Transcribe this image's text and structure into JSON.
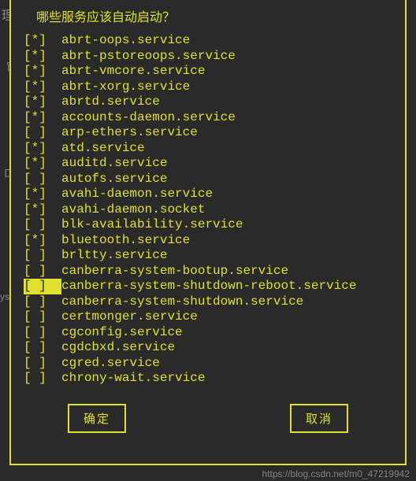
{
  "background": {
    "t1": "理工具",
    "t2": "窗口-",
    "t3": "口",
    "t4": "ys"
  },
  "dialog": {
    "title": "哪些服务应该自动启动？",
    "services": [
      {
        "checked": true,
        "name": "abrt-oops.service"
      },
      {
        "checked": true,
        "name": "abrt-pstoreoops.service"
      },
      {
        "checked": true,
        "name": "abrt-vmcore.service"
      },
      {
        "checked": true,
        "name": "abrt-xorg.service"
      },
      {
        "checked": true,
        "name": "abrtd.service"
      },
      {
        "checked": true,
        "name": "accounts-daemon.service"
      },
      {
        "checked": false,
        "name": "arp-ethers.service"
      },
      {
        "checked": true,
        "name": "atd.service"
      },
      {
        "checked": true,
        "name": "auditd.service"
      },
      {
        "checked": false,
        "name": "autofs.service"
      },
      {
        "checked": true,
        "name": "avahi-daemon.service"
      },
      {
        "checked": true,
        "name": "avahi-daemon.socket"
      },
      {
        "checked": false,
        "name": "blk-availability.service"
      },
      {
        "checked": true,
        "name": "bluetooth.service"
      },
      {
        "checked": false,
        "name": "brltty.service"
      },
      {
        "checked": false,
        "name": "canberra-system-bootup.service"
      },
      {
        "checked": false,
        "name": "canberra-system-shutdown-reboot.service",
        "highlighted": true
      },
      {
        "checked": false,
        "name": "canberra-system-shutdown.service"
      },
      {
        "checked": false,
        "name": "certmonger.service"
      },
      {
        "checked": false,
        "name": "cgconfig.service"
      },
      {
        "checked": false,
        "name": "cgdcbxd.service"
      },
      {
        "checked": false,
        "name": "cgred.service"
      },
      {
        "checked": false,
        "name": "chrony-wait.service"
      }
    ],
    "ok_label": "确定",
    "cancel_label": "取消"
  },
  "watermark": "https://blog.csdn.net/m0_47219942"
}
